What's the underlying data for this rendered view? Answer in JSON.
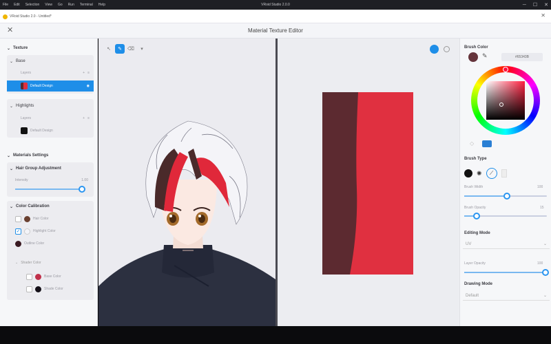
{
  "os": {
    "menu": [
      "File",
      "Edit",
      "Selection",
      "View",
      "Go",
      "Run",
      "Terminal",
      "Help"
    ],
    "window_title": "VRoid Studio 2.0.0",
    "controls": [
      "─",
      "☐",
      "✕"
    ]
  },
  "tab": {
    "label": "VRoid Studio 2.0 - Untitled*"
  },
  "editor": {
    "title": "Material Texture Editor"
  },
  "left": {
    "texture_header": "Texture",
    "base": {
      "header": "Base",
      "layers_label": "Layers",
      "layer_name": "Default Design"
    },
    "highlights": {
      "header": "Highlights",
      "layers_label": "Layers",
      "layer_name": "Default Design"
    },
    "material_header": "Materials Settings",
    "hair_group": {
      "header": "Hair Group Adjustment",
      "intensity_label": "Intensity",
      "intensity_value": "1.00",
      "intensity_fraction": 0.97
    },
    "color_cal": {
      "header": "Color Calibration",
      "rows": [
        {
          "label": "Hair Color",
          "color": "#6a4030",
          "checked": false
        },
        {
          "label": "Highlight Color",
          "color": "#f4f4f8",
          "checked": true
        },
        {
          "label": "Outline Color",
          "color": "#3a1a22",
          "checked": false
        }
      ],
      "shader_header": "Shader Color",
      "shader_rows": [
        {
          "label": "Base Color",
          "color": "#c0304a"
        },
        {
          "label": "Shade Color",
          "color": "#141018"
        }
      ]
    }
  },
  "right": {
    "brush_color_label": "Brush Color",
    "hex_value": "#65343B",
    "current_color": "#65343b",
    "brush_type_label": "Brush Type",
    "brush_width_label": "Brush Width",
    "brush_width_value": "100",
    "brush_width_fraction": 0.52,
    "brush_opacity_label": "Brush Opacity",
    "brush_opacity_value": "15",
    "brush_opacity_fraction": 0.15,
    "editing_mode_label": "Editing Mode",
    "editing_mode_value": "UV",
    "layer_opacity_label": "Layer Opacity",
    "layer_opacity_value": "100",
    "layer_opacity_fraction": 1.0,
    "drawing_mode_label": "Drawing Mode",
    "drawing_mode_value": "Default"
  },
  "texture": {
    "left_color": "#5c2a30",
    "right_color": "#e03040"
  }
}
